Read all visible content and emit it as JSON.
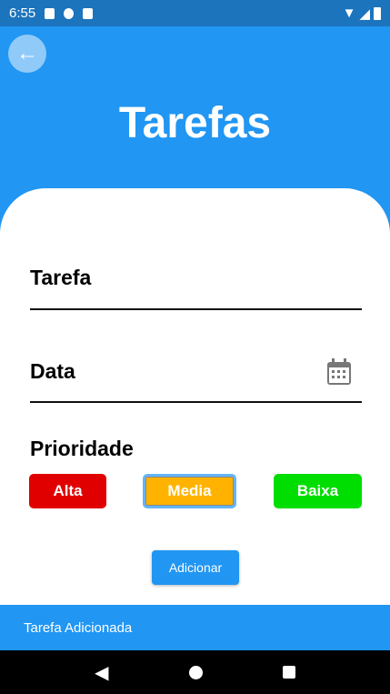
{
  "status_bar": {
    "time": "6:55"
  },
  "header": {
    "title": "Tarefas"
  },
  "form": {
    "task_label": "Tarefa",
    "date_label": "Data",
    "priority_label": "Prioridade",
    "priorities": [
      {
        "label": "Alta",
        "color": "#e00000"
      },
      {
        "label": "Media",
        "color": "#ffb300",
        "selected": true
      },
      {
        "label": "Baixa",
        "color": "#00dd00"
      }
    ],
    "add_button": "Adicionar"
  },
  "snackbar": {
    "message": "Tarefa Adicionada"
  },
  "colors": {
    "primary": "#2196f3",
    "status_bar": "#1c74bd"
  }
}
